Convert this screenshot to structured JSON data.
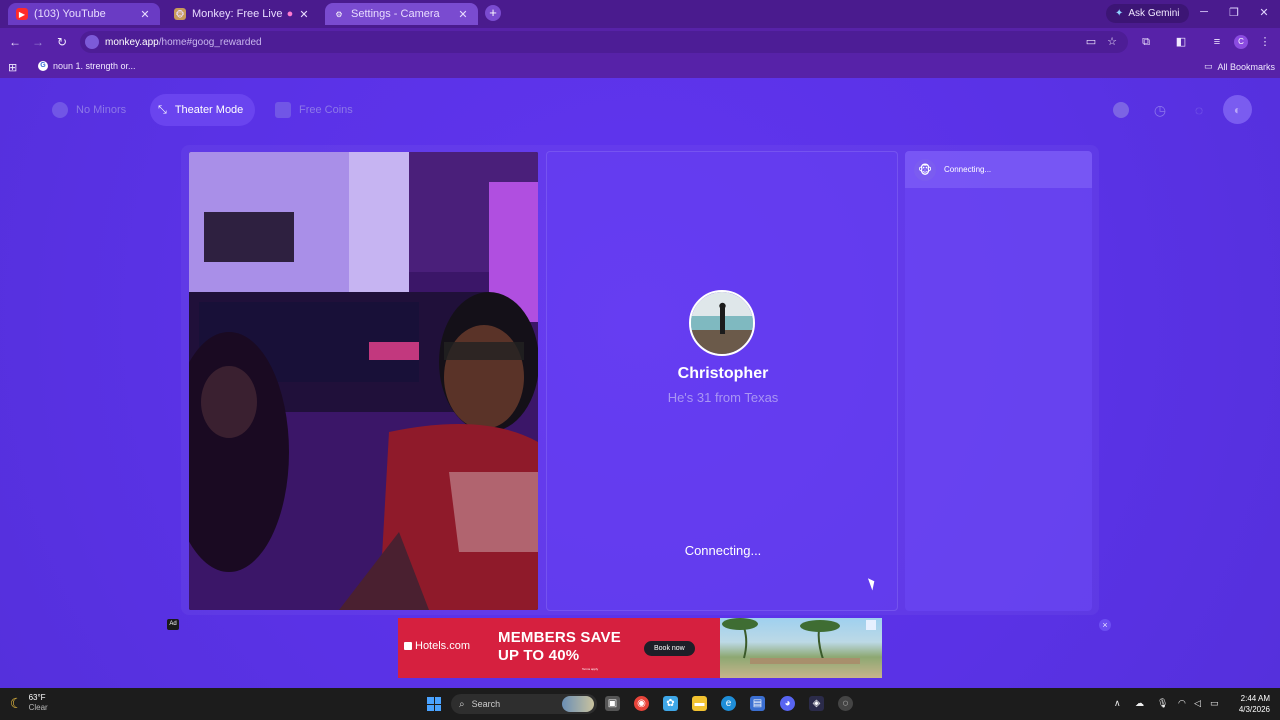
{
  "browser": {
    "tabs": [
      {
        "title": "(103) YouTube",
        "icon": "youtube-icon",
        "active": true
      },
      {
        "title": "Monkey: Free Live Video Ch",
        "icon": "monkey-icon",
        "active": false
      },
      {
        "title": "Settings - Camera",
        "icon": "gear-icon",
        "active": true
      }
    ],
    "new_tab": "+",
    "gemini_label": "Ask Gemini",
    "url_host": "monkey.app",
    "url_path": "/home#goog_rewarded",
    "bookmarks": [
      {
        "label": "noun 1. strength or..."
      }
    ],
    "all_bookmarks": "All Bookmarks",
    "profile_initial": "C"
  },
  "page": {
    "top_pills": [
      {
        "label": "No Minors",
        "state": "disabled"
      },
      {
        "label": "Theater Mode",
        "state": "active"
      },
      {
        "label": "Free Coins",
        "state": "disabled"
      }
    ],
    "match": {
      "name": "Christopher",
      "subtitle": "He's 31 from Texas",
      "status": "Connecting..."
    },
    "chat": {
      "status": "Connecting..."
    },
    "ad": {
      "tag": "Ad",
      "brand": "Hotels.com",
      "headline_line1": "MEMBERS SAVE",
      "headline_line2": "UP TO 40%",
      "cta": "Book now",
      "terms": "Terms apply",
      "close": "×"
    }
  },
  "taskbar": {
    "weather_temp": "63°F",
    "weather_desc": "Clear",
    "search_placeholder": "Search",
    "time": "2:44 AM",
    "date": "4/3/2026"
  },
  "colors": {
    "page_bg": "#5a32e6",
    "chrome_bg": "#5722a8",
    "accent": "#6a44ef",
    "ad_red": "#d6203f"
  }
}
